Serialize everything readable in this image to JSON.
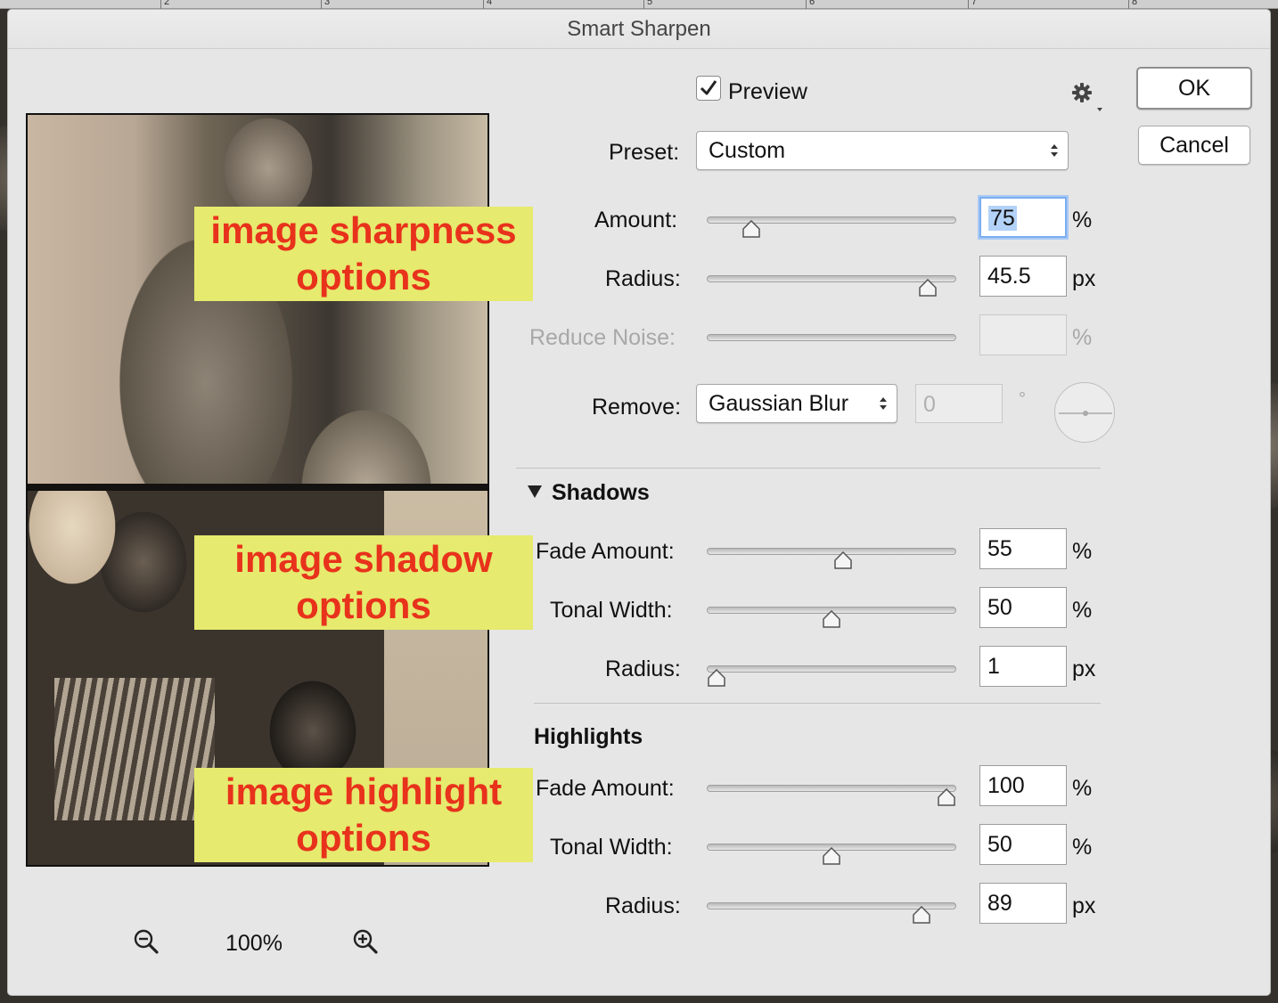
{
  "ruler": {
    "numbers": [
      "2",
      "3",
      "4",
      "5",
      "6",
      "7",
      "8"
    ]
  },
  "dialog": {
    "title": "Smart Sharpen",
    "preview_checkbox": {
      "label": "Preview",
      "checked": true
    },
    "settings_icon": "gear-icon",
    "buttons": {
      "ok": "OK",
      "cancel": "Cancel"
    },
    "preset": {
      "label": "Preset:",
      "value": "Custom"
    },
    "amount": {
      "label": "Amount:",
      "value": "75",
      "unit": "%",
      "slider_fraction": 0.15
    },
    "radius": {
      "label": "Radius:",
      "value": "45.5",
      "unit": "px",
      "slider_fraction": 0.92
    },
    "reduce_noise": {
      "label": "Reduce Noise:",
      "value": "",
      "unit": "%",
      "disabled": true
    },
    "remove": {
      "label": "Remove:",
      "value": "Gaussian Blur",
      "angle": "0",
      "angle_unit": "°"
    },
    "shadows": {
      "header": "Shadows",
      "fade_amount": {
        "label": "Fade Amount:",
        "value": "55",
        "unit": "%",
        "slider_fraction": 0.55
      },
      "tonal_width": {
        "label": "Tonal Width:",
        "value": "50",
        "unit": "%",
        "slider_fraction": 0.5
      },
      "radius": {
        "label": "Radius:",
        "value": "1",
        "unit": "px",
        "slider_fraction": 0.0
      }
    },
    "highlights": {
      "header": "Highlights",
      "fade_amount": {
        "label": "Fade Amount:",
        "value": "100",
        "unit": "%",
        "slider_fraction": 1.0
      },
      "tonal_width": {
        "label": "Tonal Width:",
        "value": "50",
        "unit": "%",
        "slider_fraction": 0.5
      },
      "radius": {
        "label": "Radius:",
        "value": "89",
        "unit": "px",
        "slider_fraction": 0.89
      }
    },
    "zoom": {
      "level": "100%",
      "zoom_out_icon": "zoom-out-icon",
      "zoom_in_icon": "zoom-in-icon"
    }
  },
  "annotations": {
    "sharpness": {
      "line1": "image sharpness",
      "line2": "options"
    },
    "shadow": {
      "line1": "image shadow",
      "line2": "options"
    },
    "highlight": {
      "line1": "image highlight",
      "line2": "options"
    },
    "color_text": "#e8321c",
    "color_fill": "#e6ea6e"
  }
}
